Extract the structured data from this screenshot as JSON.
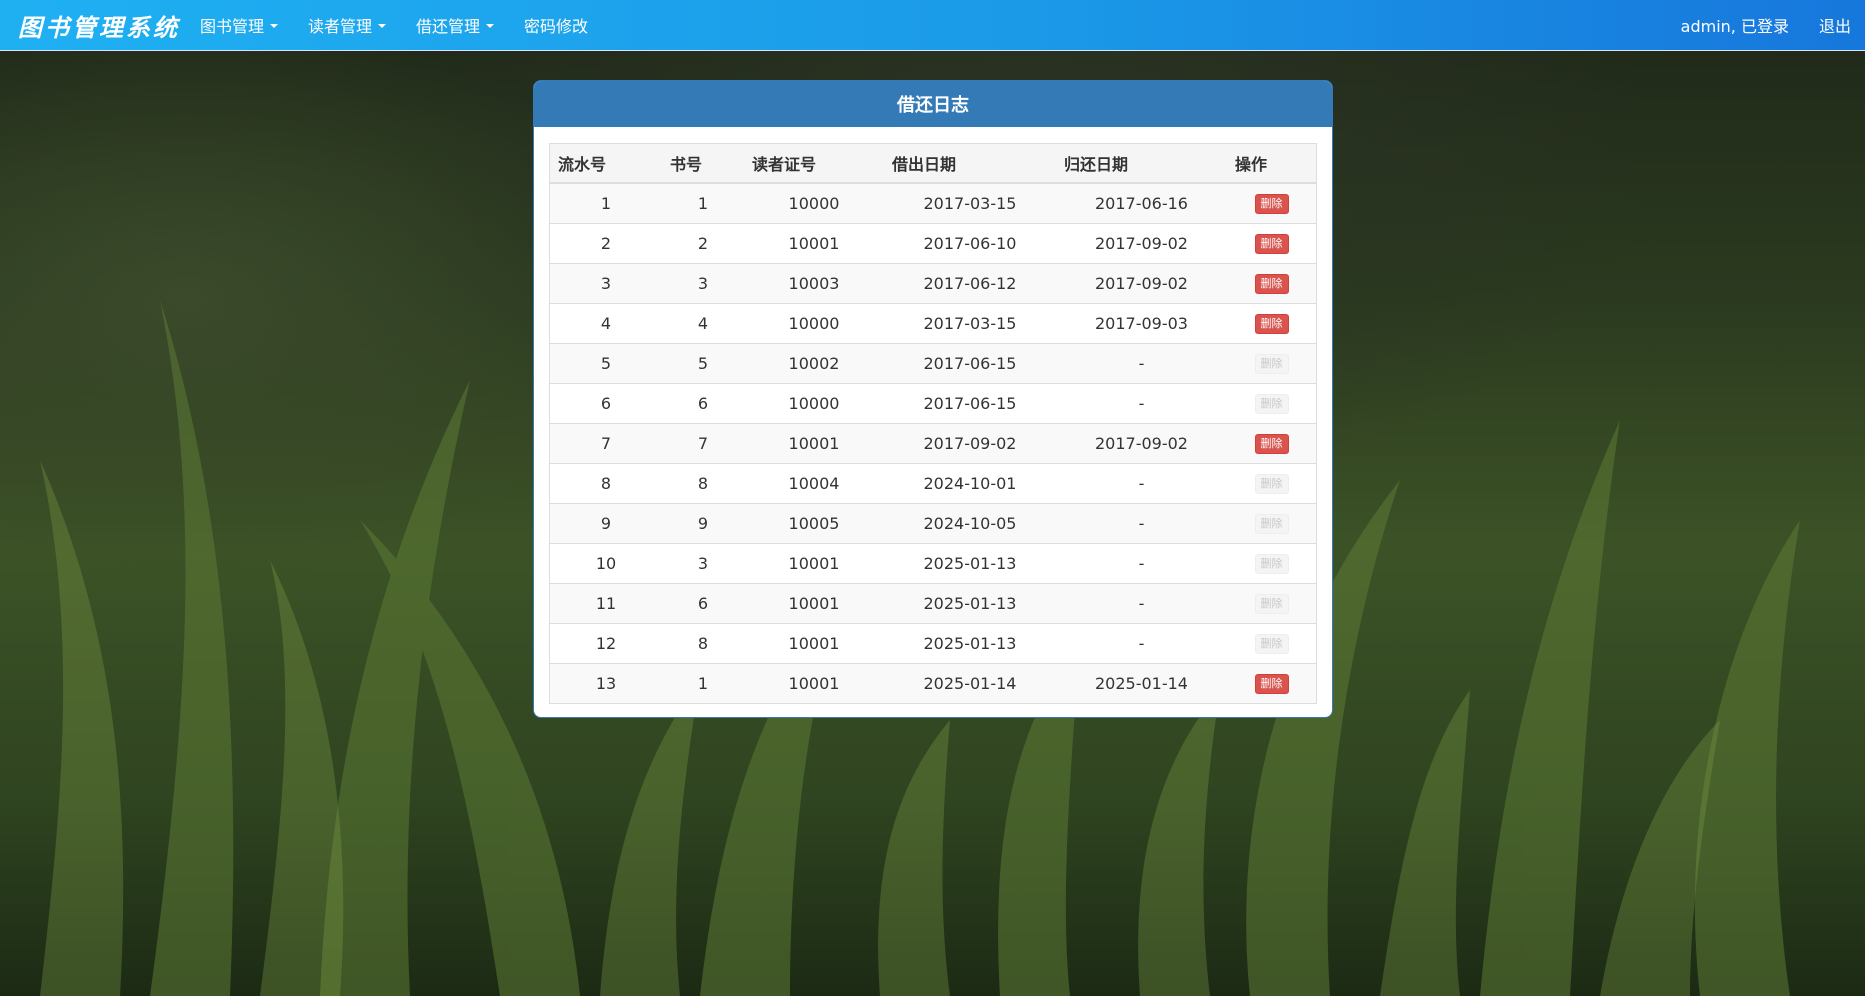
{
  "navbar": {
    "brand": "图书管理系统",
    "menu": [
      {
        "label": "图书管理",
        "dropdown": true
      },
      {
        "label": "读者管理",
        "dropdown": true
      },
      {
        "label": "借还管理",
        "dropdown": true
      },
      {
        "label": "密码修改",
        "dropdown": false
      }
    ],
    "user": "admin, 已登录",
    "logout": "退出"
  },
  "panel": {
    "title": "借还日志"
  },
  "table": {
    "headers": [
      "流水号",
      "书号",
      "读者证号",
      "借出日期",
      "归还日期",
      "操作"
    ],
    "delete_label": "删除",
    "rows": [
      {
        "serial": "1",
        "book": "1",
        "reader": "10000",
        "lend": "2017-03-15",
        "back": "2017-06-16",
        "deletable": true
      },
      {
        "serial": "2",
        "book": "2",
        "reader": "10001",
        "lend": "2017-06-10",
        "back": "2017-09-02",
        "deletable": true
      },
      {
        "serial": "3",
        "book": "3",
        "reader": "10003",
        "lend": "2017-06-12",
        "back": "2017-09-02",
        "deletable": true
      },
      {
        "serial": "4",
        "book": "4",
        "reader": "10000",
        "lend": "2017-03-15",
        "back": "2017-09-03",
        "deletable": true
      },
      {
        "serial": "5",
        "book": "5",
        "reader": "10002",
        "lend": "2017-06-15",
        "back": "-",
        "deletable": false
      },
      {
        "serial": "6",
        "book": "6",
        "reader": "10000",
        "lend": "2017-06-15",
        "back": "-",
        "deletable": false
      },
      {
        "serial": "7",
        "book": "7",
        "reader": "10001",
        "lend": "2017-09-02",
        "back": "2017-09-02",
        "deletable": true
      },
      {
        "serial": "8",
        "book": "8",
        "reader": "10004",
        "lend": "2024-10-01",
        "back": "-",
        "deletable": false
      },
      {
        "serial": "9",
        "book": "9",
        "reader": "10005",
        "lend": "2024-10-05",
        "back": "-",
        "deletable": false
      },
      {
        "serial": "10",
        "book": "3",
        "reader": "10001",
        "lend": "2025-01-13",
        "back": "-",
        "deletable": false
      },
      {
        "serial": "11",
        "book": "6",
        "reader": "10001",
        "lend": "2025-01-13",
        "back": "-",
        "deletable": false
      },
      {
        "serial": "12",
        "book": "8",
        "reader": "10001",
        "lend": "2025-01-13",
        "back": "-",
        "deletable": false
      },
      {
        "serial": "13",
        "book": "1",
        "reader": "10001",
        "lend": "2025-01-14",
        "back": "2025-01-14",
        "deletable": true
      }
    ]
  },
  "colors": {
    "navbar_start": "#1fb0f2",
    "navbar_end": "#1777dc",
    "panel_header": "#337ab7",
    "danger": "#d9534f"
  }
}
